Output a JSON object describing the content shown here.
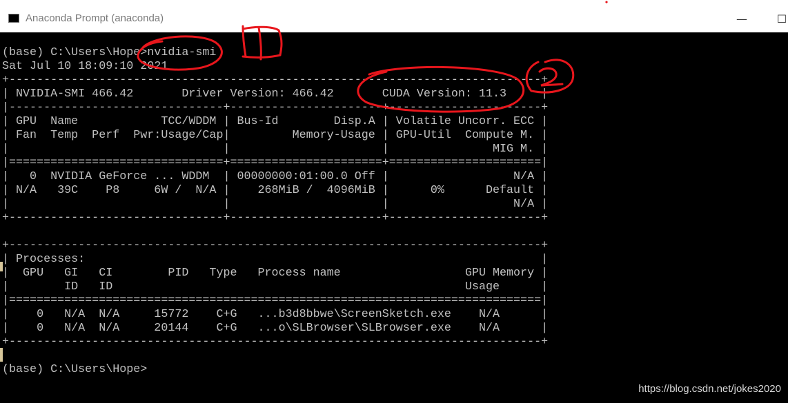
{
  "window": {
    "title": "Anaconda Prompt (anaconda)",
    "minimize_glyph": "—",
    "maximize_glyph": "☐",
    "icon": "terminal-icon"
  },
  "terminal": {
    "lines": [
      "(base) C:\\Users\\Hope>nvidia-smi",
      "Sat Jul 10 18:09:10 2021",
      "+-----------------------------------------------------------------------------+",
      "| NVIDIA-SMI 466.42       Driver Version: 466.42       CUDA Version: 11.3     |",
      "|-------------------------------+----------------------+----------------------+",
      "| GPU  Name            TCC/WDDM | Bus-Id        Disp.A | Volatile Uncorr. ECC |",
      "| Fan  Temp  Perf  Pwr:Usage/Cap|         Memory-Usage | GPU-Util  Compute M. |",
      "|                               |                      |               MIG M. |",
      "|===============================+======================+======================|",
      "|   0  NVIDIA GeForce ... WDDM  | 00000000:01:00.0 Off |                  N/A |",
      "| N/A   39C    P8     6W /  N/A |    268MiB /  4096MiB |      0%      Default |",
      "|                               |                      |                  N/A |",
      "+-------------------------------+----------------------+----------------------+",
      "",
      "+-----------------------------------------------------------------------------+",
      "| Processes:                                                                  |",
      "|  GPU   GI   CI        PID   Type   Process name                  GPU Memory |",
      "|        ID   ID                                                   Usage      |",
      "|=============================================================================|",
      "|    0   N/A  N/A     15772    C+G   ...b3d8bbwe\\ScreenSketch.exe    N/A      |",
      "|    0   N/A  N/A     20144    C+G   ...o\\SLBrowser\\SLBrowser.exe    N/A      |",
      "+-----------------------------------------------------------------------------+",
      "",
      "(base) C:\\Users\\Hope>"
    ]
  },
  "annotations": {
    "label_1": "1",
    "label_2": "2",
    "color": "#e8161c"
  },
  "watermark": "https://blog.csdn.net/jokes2020"
}
